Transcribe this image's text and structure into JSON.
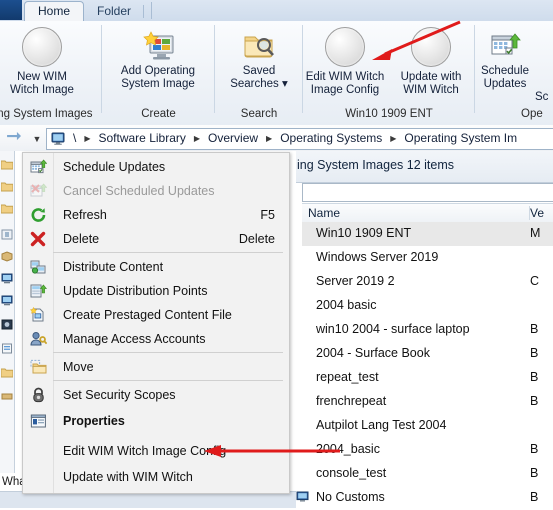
{
  "window": {
    "tabs": [
      {
        "label": "Home",
        "active": true
      },
      {
        "label": "Folder",
        "active": false
      }
    ]
  },
  "ribbon": {
    "groups": [
      {
        "label": "ting System Images",
        "buttons": [
          {
            "label_line1": "New WIM",
            "label_line2": "Witch Image",
            "icon": "circle-blank-icon"
          }
        ]
      },
      {
        "label": "Create",
        "buttons": [
          {
            "label_line1": "Add Operating",
            "label_line2": "System Image",
            "icon": "add-os-image-icon"
          }
        ]
      },
      {
        "label": "Search",
        "buttons": [
          {
            "label_line1": "Saved",
            "label_line2": "Searches ▾",
            "icon": "saved-search-folder-icon"
          }
        ]
      },
      {
        "label": "Win10 1909 ENT",
        "buttons": [
          {
            "label_line1": "Edit WIM Witch",
            "label_line2": "Image Config",
            "icon": "circle-blank-icon"
          },
          {
            "label_line1": "Update with",
            "label_line2": "WIM Witch",
            "icon": "circle-blank-icon"
          }
        ]
      },
      {
        "label": "Ope",
        "buttons": [
          {
            "label_line1": "Schedule",
            "label_line2": "Updates",
            "icon": "schedule-updates-icon"
          },
          {
            "label_line1": "Sc",
            "label_line2": "",
            "icon": "none"
          }
        ]
      }
    ]
  },
  "breadcrumb": {
    "root_icon": "computer-icon",
    "items": [
      "\\",
      "Software Library",
      "Overview",
      "Operating Systems",
      "Operating System Im"
    ]
  },
  "context_menu": {
    "items": [
      {
        "label": "Schedule Updates",
        "icon": "schedule-updates-icon",
        "accel": "",
        "disabled": false,
        "bold": false,
        "sep_after": false
      },
      {
        "label": "Cancel Scheduled Updates",
        "icon": "cancel-schedule-icon",
        "accel": "",
        "disabled": true,
        "bold": false,
        "sep_after": false
      },
      {
        "label": "Refresh",
        "icon": "refresh-icon",
        "accel": "F5",
        "disabled": false,
        "bold": false,
        "sep_after": false
      },
      {
        "label": "Delete",
        "icon": "delete-icon",
        "accel": "Delete",
        "disabled": false,
        "bold": false,
        "sep_after": true
      },
      {
        "label": "Distribute Content",
        "icon": "distribute-content-icon",
        "accel": "",
        "disabled": false,
        "bold": false,
        "sep_after": false
      },
      {
        "label": "Update Distribution Points",
        "icon": "update-dp-icon",
        "accel": "",
        "disabled": false,
        "bold": false,
        "sep_after": false
      },
      {
        "label": "Create Prestaged Content File",
        "icon": "prestaged-content-icon",
        "accel": "",
        "disabled": false,
        "bold": false,
        "sep_after": false
      },
      {
        "label": "Manage Access Accounts",
        "icon": "manage-access-icon",
        "accel": "",
        "disabled": false,
        "bold": false,
        "sep_after": true
      },
      {
        "label": "Move",
        "icon": "move-folder-icon",
        "accel": "",
        "disabled": false,
        "bold": false,
        "sep_after": true
      },
      {
        "label": "Set Security Scopes",
        "icon": "security-scope-icon",
        "accel": "",
        "disabled": false,
        "bold": false,
        "sep_after": false
      },
      {
        "label": "Properties",
        "icon": "properties-icon",
        "accel": "",
        "disabled": false,
        "bold": true,
        "sep_after": false
      },
      {
        "label": "Edit WIM Witch Image Config",
        "icon": "none",
        "accel": "",
        "disabled": false,
        "bold": false,
        "sep_after": false
      },
      {
        "label": "Update with WIM Witch",
        "icon": "none",
        "accel": "",
        "disabled": false,
        "bold": false,
        "sep_after": false
      }
    ]
  },
  "list": {
    "title": "ing System Images 12 items",
    "columns": [
      {
        "label": "Name"
      },
      {
        "label": "Ve"
      }
    ],
    "rows": [
      {
        "name": "Win10 1909 ENT",
        "version": "M",
        "selected": true
      },
      {
        "name": "Windows Server 2019",
        "version": "",
        "selected": false
      },
      {
        "name": "Server 2019 2",
        "version": "C",
        "selected": false
      },
      {
        "name": "2004 basic",
        "version": "",
        "selected": false
      },
      {
        "name": "win10 2004 - surface laptop",
        "version": "B",
        "selected": false
      },
      {
        "name": "2004 - Surface Book",
        "version": "B",
        "selected": false
      },
      {
        "name": "repeat_test",
        "version": "B",
        "selected": false
      },
      {
        "name": "frenchrepeat",
        "version": "B",
        "selected": false
      },
      {
        "name": "Autpilot Lang Test 2004",
        "version": "",
        "selected": false
      },
      {
        "name": "2004_basic",
        "version": "B",
        "selected": false
      },
      {
        "name": "console_test",
        "version": "B",
        "selected": false
      },
      {
        "name": "No Customs",
        "version": "B",
        "selected": false
      }
    ]
  },
  "nav": {
    "whats_new": "What's New"
  },
  "annotations": {
    "accent_color": "#e01b1b",
    "arrow_1_target": "Edit WIM Witch Image Config ribbon button",
    "arrow_2_target": "Edit WIM Witch Image Config menu item"
  }
}
